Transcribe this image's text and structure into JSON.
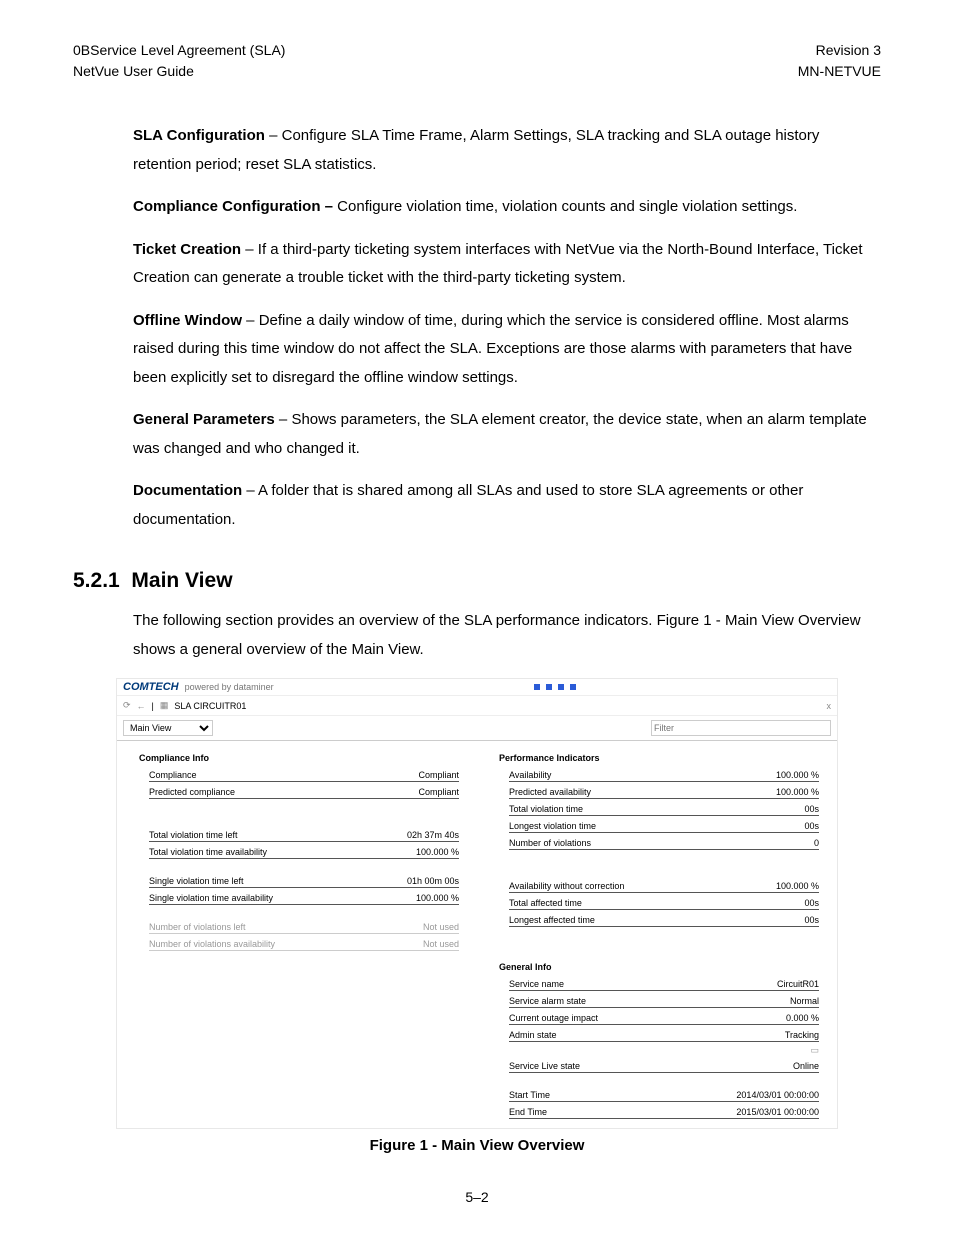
{
  "header": {
    "left1": "0BService Level Agreement (SLA)",
    "left2": "NetVue User Guide",
    "right1": "Revision 3",
    "right2": "MN-NETVUE"
  },
  "paragraphs": {
    "p1_b": "SLA Configuration",
    "p1": " – Configure SLA Time Frame, Alarm Settings, SLA tracking and SLA outage history retention period; reset SLA statistics.",
    "p2_b": "Compliance Configuration –",
    "p2": " Configure violation time, violation counts and single violation settings.",
    "p3_b": "Ticket Creation",
    "p3": " – If a third-party ticketing system interfaces with NetVue via the North-Bound Interface, Ticket Creation can generate a trouble ticket with the third-party ticketing system.",
    "p4_b": "Offline Window",
    "p4": " – Define a daily window of time, during which the service is considered offline. Most alarms raised during this time window do not affect the SLA. Exceptions are those alarms with parameters that have been explicitly set to disregard the offline window settings.",
    "p5_b": "General Parameters",
    "p5": " – Shows parameters, the SLA element creator, the device state, when an alarm template was changed and who changed it.",
    "p6_b": "Documentation",
    "p6": " – A folder that is shared among all SLAs and used to store SLA agreements or other documentation."
  },
  "section": {
    "num": "5.2.1",
    "title": "Main View",
    "intro": "The following section provides an overview of the SLA performance indicators. Figure 1 - Main View Overview shows a general overview of the Main View."
  },
  "figure": {
    "brand": "COMTECH",
    "powered": "powered by dataminer",
    "breadcrumb": "SLA CIRCUITR01",
    "close": "x",
    "view_select": "Main View",
    "filter_placeholder": "Filter",
    "caption": "Figure 1 - Main View Overview",
    "left": {
      "hdr": "Compliance Info",
      "rows1": [
        {
          "l": "Compliance",
          "v": "Compliant"
        },
        {
          "l": "Predicted compliance",
          "v": "Compliant"
        }
      ],
      "rows2": [
        {
          "l": "Total violation time left",
          "v": "02h 37m 40s"
        },
        {
          "l": "Total violation time availability",
          "v": "100.000 %"
        }
      ],
      "rows3": [
        {
          "l": "Single violation time left",
          "v": "01h 00m 00s"
        },
        {
          "l": "Single violation time availability",
          "v": "100.000 %"
        }
      ],
      "rows4": [
        {
          "l": "Number of violations left",
          "v": "Not used"
        },
        {
          "l": "Number of violations availability",
          "v": "Not used"
        }
      ]
    },
    "right": {
      "hdr1": "Performance Indicators",
      "rows1": [
        {
          "l": "Availability",
          "v": "100.000 %"
        },
        {
          "l": "Predicted availability",
          "v": "100.000 %"
        },
        {
          "l": "Total violation time",
          "v": "00s"
        },
        {
          "l": "Longest violation time",
          "v": "00s"
        },
        {
          "l": "Number of violations",
          "v": "0"
        }
      ],
      "rows2": [
        {
          "l": "Availability without correction",
          "v": "100.000 %"
        },
        {
          "l": "Total affected time",
          "v": "00s"
        },
        {
          "l": "Longest affected time",
          "v": "00s"
        }
      ],
      "hdr2": "General Info",
      "rows3": [
        {
          "l": "Service name",
          "v": "CircuitR01"
        },
        {
          "l": "Service alarm state",
          "v": "Normal"
        },
        {
          "l": "Current outage impact",
          "v": "0.000 %"
        },
        {
          "l": "Admin state",
          "v": "Tracking"
        }
      ],
      "rows4": [
        {
          "l": "Service Live state",
          "v": "Online"
        }
      ],
      "rows5": [
        {
          "l": "Start Time",
          "v": "2014/03/01 00:00:00"
        },
        {
          "l": "End Time",
          "v": "2015/03/01 00:00:00"
        }
      ]
    }
  },
  "pagenum": "5–2"
}
